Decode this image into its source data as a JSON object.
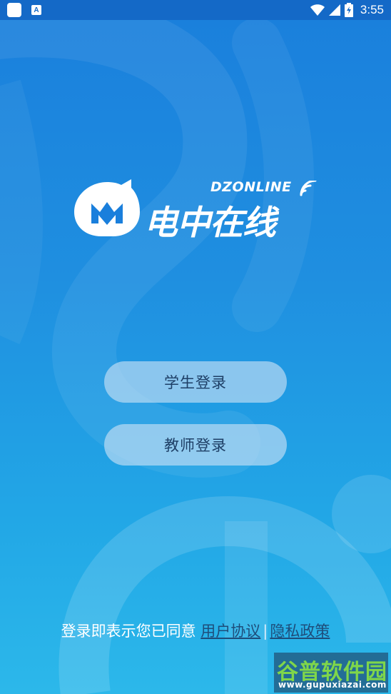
{
  "status_bar": {
    "time": "3:55",
    "icons": [
      "app-square-icon",
      "a-notification-icon",
      "wifi-icon",
      "signal-icon",
      "battery-charging-icon"
    ]
  },
  "logo": {
    "latin": "DZONLINE",
    "chinese": "电中在线"
  },
  "buttons": {
    "student_login": "学生登录",
    "teacher_login": "教师登录"
  },
  "agreement": {
    "prefix": "登录即表示您已同意",
    "user_agreement": "用户协议",
    "separator": "|",
    "privacy_policy": "隐私政策"
  },
  "watermark": {
    "title": "谷普软件园",
    "url": "www.gupuxiazai.com"
  },
  "colors": {
    "background_top": "#1a7fdc",
    "background_bottom": "#2cb8ea",
    "status_bar": "#1469c7",
    "button_fill": "#cde2f6",
    "button_text": "#1e3f66",
    "link_text": "#1e4d7a"
  }
}
